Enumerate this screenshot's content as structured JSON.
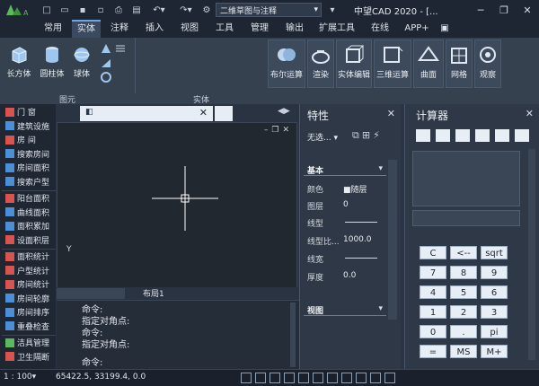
{
  "titlebar": {
    "workspace": "二维草图与注释",
    "title": "中望CAD 2020 - [..."
  },
  "menu": [
    "常用",
    "实体",
    "注释",
    "插入",
    "视图",
    "工具",
    "管理",
    "输出",
    "扩展工具",
    "在线",
    "APP+"
  ],
  "ribbon": {
    "primitives": [
      "长方体",
      "圆柱体",
      "球体"
    ],
    "tools": [
      "布尔运算",
      "渲染",
      "实体编辑",
      "三维运算",
      "曲面",
      "网格",
      "观察"
    ],
    "groups": [
      "图元",
      "实体"
    ]
  },
  "left_panel": [
    "门    窗",
    "建筑设施",
    "房    间",
    "搜索房间",
    "房间面积",
    "搜索户型",
    "阳台面积",
    "曲线面积",
    "面积累加",
    "设面积层",
    "面积统计",
    "户型统计",
    "房间统计",
    "房间轮廓",
    "房间排序",
    "重叠检查",
    "洁具管理",
    "卫生隔断"
  ],
  "canvas": {
    "axis_label": "Y"
  },
  "layout_tab": "布局1",
  "commands": [
    "命令:",
    "指定对角点:",
    "命令:",
    "指定对角点:",
    "命令:"
  ],
  "properties": {
    "title": "特性",
    "selection": "无选...",
    "section_basic": "基本",
    "rows": [
      {
        "label": "颜色",
        "value": "■随层"
      },
      {
        "label": "图层",
        "value": "0"
      },
      {
        "label": "线型",
        "value": ""
      },
      {
        "label": "线型比...",
        "value": "1000.0"
      },
      {
        "label": "线宽",
        "value": ""
      },
      {
        "label": "厚度",
        "value": "0.0"
      }
    ],
    "section_view": "视图"
  },
  "calculator": {
    "title": "计算器",
    "buttons": [
      "C",
      "<--",
      "sqrt",
      "7",
      "8",
      "9",
      "4",
      "5",
      "6",
      "1",
      "2",
      "3",
      "0",
      ".",
      "pi",
      "=",
      "MS",
      "M+"
    ]
  },
  "status": {
    "scale": "1 : 100▾",
    "coords": "65422.5, 33199.4, 0.0"
  },
  "colors": {
    "accent": "#6ea6e6",
    "dark": "#1e2633",
    "panel": "#2f3846"
  }
}
